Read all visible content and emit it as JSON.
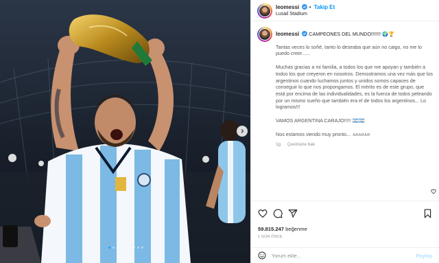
{
  "post": {
    "username": "leomessi",
    "follow_label": "Takip Et",
    "location": "Lusail Stadium"
  },
  "caption": {
    "username": "leomessi",
    "first_line": "CAMPEONES DEL MUNDO!!!!!!! 🌍🏆",
    "paragraphs": [
      "Tantas veces lo soñé, tanto lo deseaba que aún no caigo, no me lo puedo creer......",
      "Muchas gracias a mi familia, a todos los que me apoyan y también a todos los que creyeron en nosotros. Demostramos una vez más que los argentinos cuando luchamos juntos y unidos somos capaces de conseguir lo que nos propongamos. El mérito es de este grupo, que está por encima de las individualidades, es la fuerza de todos peleando por un mismo sueño que también era el de todos los argentinos... Lo logramos!!!",
      "VAMOS ARGENTINA CARAJO!!!!! 🇦🇷🇦🇷"
    ],
    "last_line": "Nos estamos viendo muy pronto...",
    "more_label": "ARARAR",
    "age": "1g",
    "see_translation": "Çevirisine bak"
  },
  "actions": {
    "likes_count": "59.815.247",
    "likes_label": "beğenme",
    "time_ago": "1 GÜN ÖNCE"
  },
  "comment": {
    "placeholder": "Yorum ekle...",
    "post_label": "Paylaş"
  },
  "carousel": {
    "total": 9,
    "active": 0
  },
  "colors": {
    "accent": "#0095f6",
    "verified": "#3897f0",
    "border": "#efefef"
  },
  "icons": [
    "chevron-right-icon",
    "verified-icon",
    "heart-icon",
    "comment-icon",
    "share-icon",
    "bookmark-icon",
    "emoji-icon"
  ]
}
